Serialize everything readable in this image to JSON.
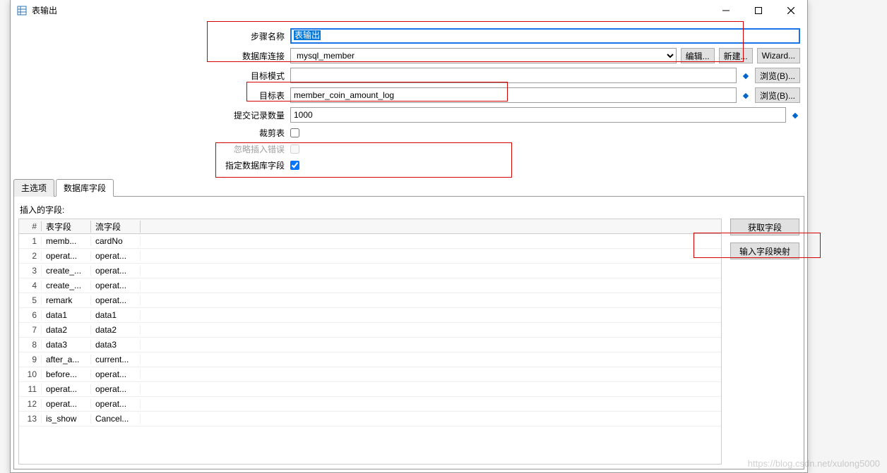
{
  "dialog": {
    "title": "表输出"
  },
  "form": {
    "step_name_label": "步骤名称",
    "step_name_value": "表输出",
    "db_conn_label": "数据库连接",
    "db_conn_value": "mysql_member",
    "btn_edit": "编辑...",
    "btn_new": "新建...",
    "btn_wizard": "Wizard...",
    "target_schema_label": "目标模式",
    "target_schema_value": "",
    "btn_browse": "浏览(B)...",
    "target_table_label": "目标表",
    "target_table_value": "member_coin_amount_log",
    "commit_size_label": "提交记录数量",
    "commit_size_value": "1000",
    "truncate_label": "裁剪表",
    "truncate_checked": false,
    "ignore_errors_label": "忽略插入错误",
    "ignore_errors_checked": false,
    "specify_fields_label": "指定数据库字段",
    "specify_fields_checked": true
  },
  "tabs": {
    "main": "主选项",
    "fields": "数据库字段"
  },
  "fields_panel": {
    "label": "插入的字段:",
    "header_num": "#",
    "header_table": "表字段",
    "header_stream": "流字段",
    "btn_get": "获取字段",
    "btn_map": "输入字段映射",
    "rows": [
      {
        "n": "1",
        "t": "memb...",
        "s": "cardNo"
      },
      {
        "n": "2",
        "t": "operat...",
        "s": "operat..."
      },
      {
        "n": "3",
        "t": "create_...",
        "s": "operat..."
      },
      {
        "n": "4",
        "t": "create_...",
        "s": "operat..."
      },
      {
        "n": "5",
        "t": "remark",
        "s": "operat..."
      },
      {
        "n": "6",
        "t": "data1",
        "s": "data1"
      },
      {
        "n": "7",
        "t": "data2",
        "s": "data2"
      },
      {
        "n": "8",
        "t": "data3",
        "s": "data3"
      },
      {
        "n": "9",
        "t": "after_a...",
        "s": "current..."
      },
      {
        "n": "10",
        "t": "before...",
        "s": "operat..."
      },
      {
        "n": "11",
        "t": "operat...",
        "s": "operat..."
      },
      {
        "n": "12",
        "t": "operat...",
        "s": "operat..."
      },
      {
        "n": "13",
        "t": "is_show",
        "s": "Cancel..."
      }
    ]
  },
  "watermark": "https://blog.csdn.net/xulong5000"
}
